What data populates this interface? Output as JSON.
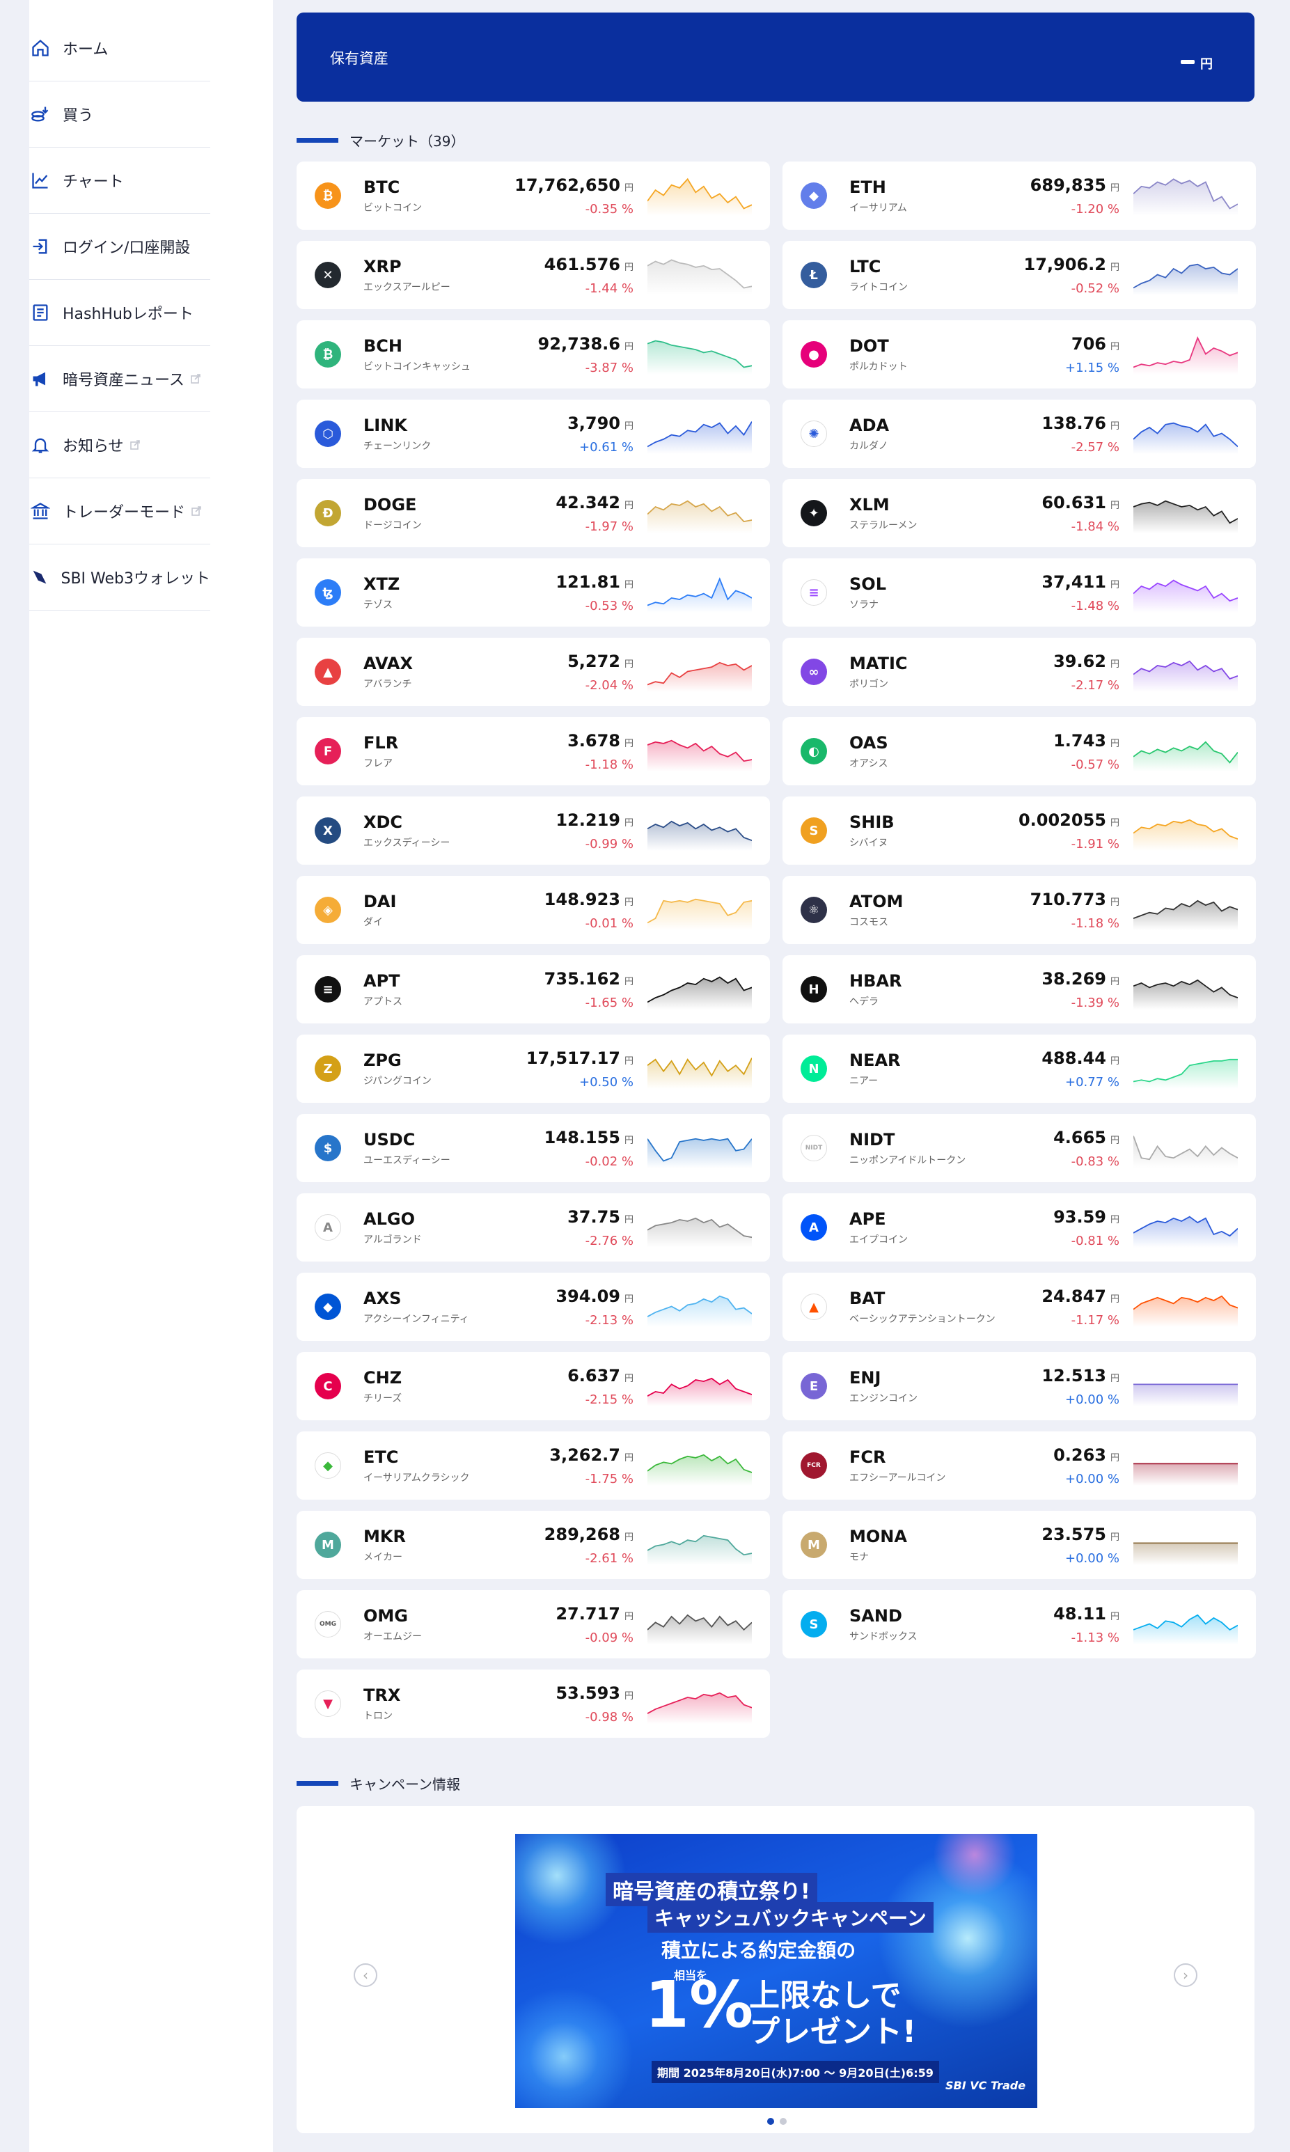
{
  "sidebar": {
    "items": [
      {
        "label": "ホーム",
        "icon": "home-icon",
        "external": false
      },
      {
        "label": "買う",
        "icon": "coins-icon",
        "external": false
      },
      {
        "label": "チャート",
        "icon": "chart-icon",
        "external": false
      },
      {
        "label": "ログイン/口座開設",
        "icon": "login-icon",
        "external": false
      },
      {
        "label": "HashHubレポート",
        "icon": "report-icon",
        "external": false
      },
      {
        "label": "暗号資産ニュース",
        "icon": "megaphone-icon",
        "external": true
      },
      {
        "label": "お知らせ",
        "icon": "bell-icon",
        "external": true
      },
      {
        "label": "トレーダーモード",
        "icon": "bank-icon",
        "external": true
      },
      {
        "label": "SBI Web3ウォレット",
        "icon": "wallet-icon",
        "external": false
      }
    ]
  },
  "assets": {
    "title": "保有資産",
    "unit": "円"
  },
  "market": {
    "title": "マーケット",
    "count": "（39）",
    "coins": [
      {
        "symbol": "BTC",
        "jp": "ビットコイン",
        "price": "17,762,650",
        "change": "-0.35 %",
        "dir": "neg",
        "color": "#f7931a",
        "spark": [
          40,
          55,
          48,
          62,
          58,
          70,
          52,
          60,
          44,
          50,
          38,
          46,
          30,
          35
        ],
        "line": "#f5a623"
      },
      {
        "symbol": "ETH",
        "jp": "イーサリアム",
        "price": "689,835",
        "change": "-1.20 %",
        "dir": "neg",
        "color": "#627eea",
        "spark": [
          50,
          60,
          58,
          66,
          62,
          70,
          64,
          68,
          60,
          66,
          40,
          46,
          30,
          36
        ],
        "line": "#8a86c8"
      },
      {
        "symbol": "XRP",
        "jp": "エックスアールピー",
        "price": "461.576",
        "change": "-1.44 %",
        "dir": "neg",
        "color": "#23292f",
        "spark": [
          60,
          66,
          62,
          68,
          64,
          62,
          58,
          60,
          55,
          56,
          48,
          40,
          30,
          32
        ],
        "line": "#bbbbbb"
      },
      {
        "symbol": "LTC",
        "jp": "ライトコイン",
        "price": "17,906.2",
        "change": "-0.52 %",
        "dir": "neg",
        "color": "#345d9d",
        "spark": [
          30,
          36,
          40,
          48,
          44,
          56,
          50,
          60,
          62,
          56,
          58,
          50,
          48,
          56
        ],
        "line": "#3a63c0"
      },
      {
        "symbol": "BCH",
        "jp": "ビットコインキャッシュ",
        "price": "92,738.6",
        "change": "-3.87 %",
        "dir": "neg",
        "color": "#2fb47c",
        "spark": [
          62,
          66,
          64,
          60,
          58,
          56,
          54,
          50,
          52,
          48,
          44,
          40,
          30,
          32
        ],
        "line": "#2fbf8a"
      },
      {
        "symbol": "DOT",
        "jp": "ポルカドット",
        "price": "706",
        "change": "+1.15 %",
        "dir": "pos",
        "color": "#e6007a",
        "spark": [
          30,
          34,
          32,
          36,
          34,
          38,
          36,
          40,
          70,
          48,
          56,
          52,
          46,
          50
        ],
        "line": "#e8377f"
      },
      {
        "symbol": "LINK",
        "jp": "チェーンリンク",
        "price": "3,790",
        "change": "+0.61 %",
        "dir": "pos",
        "color": "#2a5ada",
        "spark": [
          30,
          36,
          40,
          46,
          44,
          52,
          50,
          60,
          56,
          62,
          48,
          58,
          46,
          64
        ],
        "line": "#2a5ada"
      },
      {
        "symbol": "ADA",
        "jp": "カルダノ",
        "price": "138.76",
        "change": "-2.57 %",
        "dir": "neg",
        "color": "#ffffff",
        "spark": [
          40,
          50,
          56,
          48,
          60,
          62,
          58,
          56,
          50,
          60,
          44,
          48,
          40,
          30
        ],
        "line": "#2a5ada"
      },
      {
        "symbol": "DOGE",
        "jp": "ドージコイン",
        "price": "42.342",
        "change": "-1.97 %",
        "dir": "neg",
        "color": "#c2a633",
        "spark": [
          46,
          56,
          52,
          60,
          58,
          64,
          56,
          60,
          50,
          56,
          44,
          48,
          36,
          38
        ],
        "line": "#d6a64a"
      },
      {
        "symbol": "XLM",
        "jp": "ステラルーメン",
        "price": "60.631",
        "change": "-1.84 %",
        "dir": "neg",
        "color": "#14161a",
        "spark": [
          56,
          60,
          62,
          58,
          64,
          60,
          56,
          58,
          52,
          56,
          44,
          50,
          34,
          40
        ],
        "line": "#222222"
      },
      {
        "symbol": "XTZ",
        "jp": "テゾス",
        "price": "121.81",
        "change": "-0.53 %",
        "dir": "neg",
        "color": "#2c7df7",
        "spark": [
          30,
          34,
          32,
          40,
          38,
          44,
          42,
          46,
          40,
          66,
          38,
          50,
          46,
          40
        ],
        "line": "#2c7df7"
      },
      {
        "symbol": "SOL",
        "jp": "ソラナ",
        "price": "37,411",
        "change": "-1.48 %",
        "dir": "neg",
        "color": "#ffffff",
        "spark": [
          46,
          56,
          52,
          60,
          56,
          64,
          58,
          54,
          50,
          56,
          40,
          46,
          36,
          40
        ],
        "line": "#9945ff"
      },
      {
        "symbol": "AVAX",
        "jp": "アバランチ",
        "price": "5,272",
        "change": "-2.04 %",
        "dir": "neg",
        "color": "#e84142",
        "spark": [
          30,
          34,
          32,
          46,
          40,
          48,
          50,
          52,
          54,
          60,
          56,
          58,
          50,
          56
        ],
        "line": "#e84142"
      },
      {
        "symbol": "MATIC",
        "jp": "ポリゴン",
        "price": "39.62",
        "change": "-2.17 %",
        "dir": "neg",
        "color": "#8247e5",
        "spark": [
          44,
          52,
          48,
          56,
          54,
          60,
          56,
          62,
          50,
          56,
          48,
          52,
          38,
          42
        ],
        "line": "#8247e5"
      },
      {
        "symbol": "FLR",
        "jp": "フレア",
        "price": "3.678",
        "change": "-1.18 %",
        "dir": "neg",
        "color": "#e62058",
        "spark": [
          56,
          60,
          58,
          62,
          56,
          52,
          58,
          48,
          54,
          44,
          40,
          46,
          34,
          36
        ],
        "line": "#e62058"
      },
      {
        "symbol": "OAS",
        "jp": "オアシス",
        "price": "1.743",
        "change": "-0.57 %",
        "dir": "neg",
        "color": "#19b86a",
        "spark": [
          40,
          48,
          44,
          50,
          46,
          52,
          48,
          54,
          50,
          60,
          48,
          44,
          32,
          46
        ],
        "line": "#28c76f"
      },
      {
        "symbol": "XDC",
        "jp": "エックスディーシー",
        "price": "12.219",
        "change": "-0.99 %",
        "dir": "neg",
        "color": "#244b81",
        "spark": [
          50,
          56,
          52,
          60,
          54,
          58,
          50,
          56,
          48,
          52,
          46,
          50,
          38,
          34
        ],
        "line": "#2b4d88"
      },
      {
        "symbol": "SHIB",
        "jp": "シバイヌ",
        "price": "0.002055",
        "change": "-1.91 %",
        "dir": "neg",
        "color": "#f0a020",
        "spark": [
          44,
          52,
          50,
          56,
          54,
          60,
          58,
          62,
          56,
          54,
          46,
          50,
          40,
          36
        ],
        "line": "#f5a623"
      },
      {
        "symbol": "DAI",
        "jp": "ダイ",
        "price": "148.923",
        "change": "-0.01 %",
        "dir": "neg",
        "color": "#f5ac37",
        "spark": [
          30,
          36,
          60,
          58,
          60,
          58,
          62,
          60,
          58,
          56,
          40,
          44,
          58,
          60
        ],
        "line": "#f5b94a"
      },
      {
        "symbol": "ATOM",
        "jp": "コスモス",
        "price": "710.773",
        "change": "-1.18 %",
        "dir": "neg",
        "color": "#2e3148",
        "spark": [
          36,
          40,
          44,
          42,
          50,
          48,
          56,
          52,
          60,
          54,
          58,
          46,
          52,
          48
        ],
        "line": "#333333"
      },
      {
        "symbol": "APT",
        "jp": "アプトス",
        "price": "735.162",
        "change": "-1.65 %",
        "dir": "neg",
        "color": "#111111",
        "spark": [
          30,
          36,
          40,
          46,
          50,
          56,
          54,
          62,
          58,
          64,
          56,
          62,
          46,
          50
        ],
        "line": "#111111"
      },
      {
        "symbol": "HBAR",
        "jp": "ヘデラ",
        "price": "38.269",
        "change": "-1.39 %",
        "dir": "neg",
        "color": "#111111",
        "spark": [
          52,
          56,
          50,
          54,
          56,
          52,
          58,
          54,
          60,
          52,
          44,
          50,
          40,
          36
        ],
        "line": "#222222"
      },
      {
        "symbol": "ZPG",
        "jp": "ジパングコイン",
        "price": "17,517.17",
        "change": "+0.50 %",
        "dir": "pos",
        "color": "#d4a017",
        "spark": [
          52,
          60,
          44,
          58,
          40,
          60,
          46,
          56,
          38,
          58,
          44,
          52,
          40,
          62
        ],
        "line": "#d4a017"
      },
      {
        "symbol": "NEAR",
        "jp": "ニアー",
        "price": "488.44",
        "change": "+0.77 %",
        "dir": "pos",
        "color": "#00ec97",
        "spark": [
          30,
          32,
          30,
          34,
          32,
          36,
          40,
          52,
          54,
          56,
          58,
          58,
          60,
          60
        ],
        "line": "#2bd68a"
      },
      {
        "symbol": "USDC",
        "jp": "ユーエスディーシー",
        "price": "148.155",
        "change": "-0.02 %",
        "dir": "neg",
        "color": "#2775ca",
        "spark": [
          60,
          44,
          30,
          34,
          56,
          58,
          60,
          58,
          60,
          58,
          60,
          44,
          46,
          60
        ],
        "line": "#2775ca"
      },
      {
        "symbol": "NIDT",
        "jp": "ニッポンアイドルトークン",
        "price": "4.665",
        "change": "-0.83 %",
        "dir": "neg",
        "color": "#ffffff",
        "spark": [
          64,
          34,
          32,
          50,
          36,
          34,
          40,
          46,
          36,
          50,
          38,
          48,
          40,
          34
        ],
        "line": "#aaaaaa"
      },
      {
        "symbol": "ALGO",
        "jp": "アルゴランド",
        "price": "37.75",
        "change": "-2.76 %",
        "dir": "neg",
        "color": "#ffffff",
        "spark": [
          44,
          50,
          52,
          54,
          58,
          56,
          60,
          54,
          58,
          48,
          52,
          44,
          36,
          34
        ],
        "line": "#888888"
      },
      {
        "symbol": "APE",
        "jp": "エイプコイン",
        "price": "93.59",
        "change": "-0.81 %",
        "dir": "neg",
        "color": "#0054f9",
        "spark": [
          40,
          46,
          52,
          56,
          54,
          60,
          56,
          62,
          54,
          60,
          38,
          42,
          36,
          46
        ],
        "line": "#2a5ada"
      },
      {
        "symbol": "AXS",
        "jp": "アクシーインフィニティ",
        "price": "394.09",
        "change": "-2.13 %",
        "dir": "neg",
        "color": "#0055d5",
        "spark": [
          34,
          40,
          44,
          48,
          42,
          50,
          52,
          58,
          54,
          62,
          58,
          44,
          46,
          38
        ],
        "line": "#4fb3f0"
      },
      {
        "symbol": "BAT",
        "jp": "ベーシックアテンショントークン",
        "price": "24.847",
        "change": "-1.17 %",
        "dir": "neg",
        "color": "#ffffff",
        "spark": [
          44,
          52,
          56,
          60,
          56,
          52,
          60,
          58,
          54,
          60,
          56,
          62,
          50,
          46
        ],
        "line": "#ff5000"
      },
      {
        "symbol": "CHZ",
        "jp": "チリーズ",
        "price": "6.637",
        "change": "-2.15 %",
        "dir": "neg",
        "color": "#e5004d",
        "spark": [
          34,
          40,
          38,
          50,
          44,
          48,
          56,
          54,
          58,
          50,
          56,
          44,
          40,
          36
        ],
        "line": "#e5004d"
      },
      {
        "symbol": "ENJ",
        "jp": "エンジンコイン",
        "price": "12.513",
        "change": "+0.00 %",
        "dir": "pos",
        "color": "#7866d5",
        "spark": [
          50,
          50,
          50,
          50,
          50,
          50,
          50,
          50,
          50,
          50,
          50,
          50,
          50,
          50
        ],
        "line": "#7866d5"
      },
      {
        "symbol": "ETC",
        "jp": "イーサリアムクラシック",
        "price": "3,262.7",
        "change": "-1.75 %",
        "dir": "neg",
        "color": "#ffffff",
        "spark": [
          40,
          48,
          52,
          50,
          56,
          60,
          58,
          62,
          54,
          60,
          50,
          56,
          42,
          38
        ],
        "line": "#3ab83a"
      },
      {
        "symbol": "FCR",
        "jp": "エフシーアールコイン",
        "price": "0.263",
        "change": "+0.00 %",
        "dir": "pos",
        "color": "#a0172f",
        "spark": [
          50,
          50,
          50,
          50,
          50,
          50,
          50,
          50,
          50,
          50,
          50,
          50,
          50,
          50
        ],
        "line": "#a0172f"
      },
      {
        "symbol": "MKR",
        "jp": "メイカー",
        "price": "289,268",
        "change": "-2.61 %",
        "dir": "neg",
        "color": "#4fa89b",
        "spark": [
          40,
          46,
          48,
          52,
          48,
          54,
          52,
          60,
          58,
          56,
          54,
          42,
          34,
          36
        ],
        "line": "#4fa89b"
      },
      {
        "symbol": "MONA",
        "jp": "モナ",
        "price": "23.575",
        "change": "+0.00 %",
        "dir": "pos",
        "color": "#c8a96e",
        "spark": [
          50,
          50,
          50,
          50,
          50,
          50,
          50,
          50,
          50,
          50,
          50,
          50,
          50,
          50
        ],
        "line": "#8a6a3a"
      },
      {
        "symbol": "OMG",
        "jp": "オーエムジー",
        "price": "27.717",
        "change": "-0.09 %",
        "dir": "neg",
        "color": "#ffffff",
        "spark": [
          40,
          50,
          44,
          58,
          48,
          60,
          52,
          56,
          44,
          58,
          46,
          52,
          40,
          50
        ],
        "line": "#555555"
      },
      {
        "symbol": "SAND",
        "jp": "サンドボックス",
        "price": "48.11",
        "change": "-1.13 %",
        "dir": "neg",
        "color": "#04adef",
        "spark": [
          40,
          44,
          48,
          42,
          52,
          50,
          44,
          54,
          60,
          48,
          56,
          50,
          40,
          46
        ],
        "line": "#04adef"
      },
      {
        "symbol": "TRX",
        "jp": "トロン",
        "price": "53.593",
        "change": "-0.98 %",
        "dir": "neg",
        "color": "#ffffff",
        "spark": [
          34,
          40,
          44,
          48,
          52,
          56,
          54,
          60,
          58,
          62,
          56,
          58,
          46,
          42
        ],
        "line": "#e62058"
      }
    ]
  },
  "campaign": {
    "title": "キャンペーン情報",
    "banner": {
      "line1": "暗号資産の積立祭り!",
      "line2": "キャッシュバックキャンペーン",
      "line3": "積立による約定金額の",
      "sub": "相当を",
      "percent": "1%",
      "line4": "上限なしで",
      "line5": "プレゼント!",
      "period": "期間 2025年8月20日(水)7:00 ～ 9月20日(土)6:59",
      "brand": "SBI VC Trade"
    },
    "prev": "‹",
    "next": "›",
    "slides": 2,
    "active": 0
  },
  "colors": {
    "accent": "#1446b8",
    "header_bg": "#0a2f9e",
    "negative": "#e04a5a",
    "positive": "#2a6fe0"
  }
}
